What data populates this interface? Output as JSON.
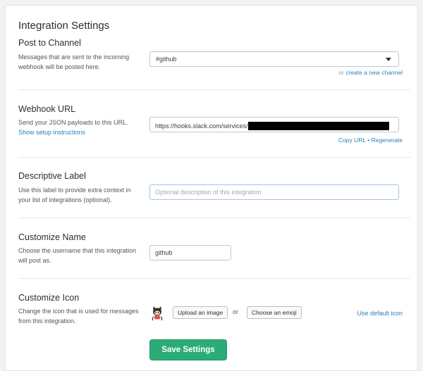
{
  "page": {
    "title": "Integration Settings"
  },
  "post_to_channel": {
    "title": "Post to Channel",
    "description": "Messages that are sent to the incoming webhook will be posted here.",
    "selected": "#github",
    "or_text": "or",
    "create_link": "create a new channel"
  },
  "webhook": {
    "title": "Webhook URL",
    "description": "Send your JSON payloads to this URL.",
    "setup_link": "Show setup instructions",
    "url_prefix": "https://hooks.slack.com/services/",
    "copy_link": "Copy URL",
    "separator": "•",
    "regenerate_link": "Regenerate"
  },
  "label": {
    "title": "Descriptive Label",
    "description": "Use this label to provide extra context in your list of integrations (optional).",
    "placeholder": "Optional description of this integration"
  },
  "name": {
    "title": "Customize Name",
    "description": "Choose the username that this integration will post as.",
    "value": "github"
  },
  "icon": {
    "title": "Customize Icon",
    "description": "Change the icon that is used for messages from this integration.",
    "upload_label": "Upload an image",
    "or_text": "or",
    "emoji_label": "Choose an emoji",
    "default_link": "Use default icon"
  },
  "actions": {
    "save_label": "Save Settings"
  },
  "colors": {
    "accent_link": "#2a80b9",
    "save_button": "#2bac76"
  }
}
